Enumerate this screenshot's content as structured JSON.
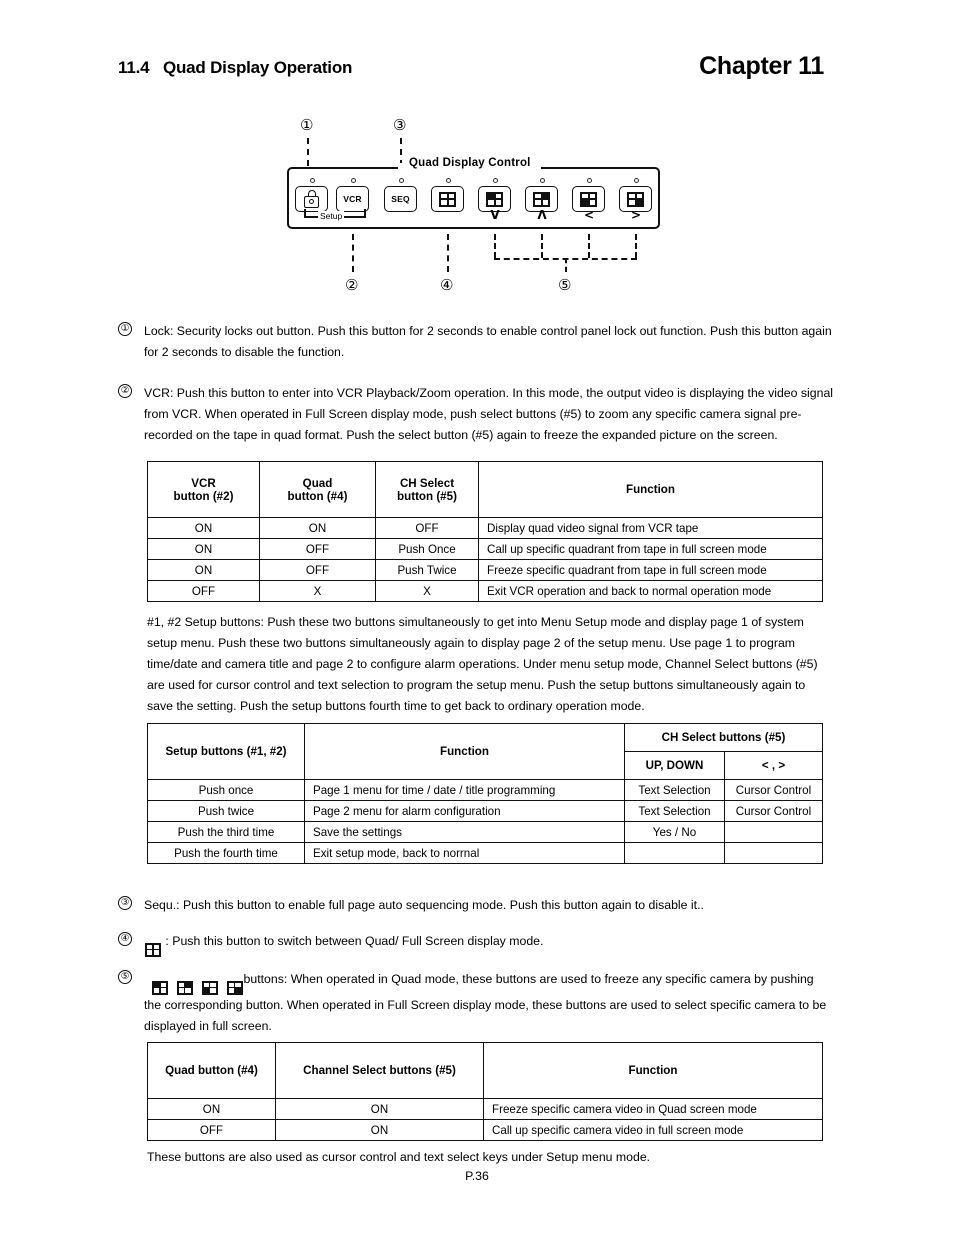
{
  "header": {
    "section_number": "11.4",
    "section_title": "Quad Display Operation",
    "chapter": "Chapter 11"
  },
  "diagram": {
    "panel_title": "Quad Display Control",
    "setup_bracket_label": "Setup",
    "callouts": [
      "①",
      "②",
      "③",
      "④",
      "⑤"
    ],
    "buttons": [
      {
        "name": "lock-button",
        "label": "",
        "icon": "lock-icon",
        "arrow": ""
      },
      {
        "name": "vcr-button",
        "label": "VCR",
        "icon": "text",
        "arrow": ""
      },
      {
        "name": "seq-button",
        "label": "SEQ",
        "icon": "text",
        "arrow": ""
      },
      {
        "name": "quad-button",
        "label": "",
        "icon": "quad-icon",
        "arrow": ""
      },
      {
        "name": "ch1-select-button",
        "label": "",
        "icon": "quad-top-left-icon",
        "arrow": "V"
      },
      {
        "name": "ch2-select-button",
        "label": "",
        "icon": "quad-top-right-icon",
        "arrow": "Λ"
      },
      {
        "name": "ch3-select-button",
        "label": "",
        "icon": "quad-bottom-left-icon",
        "arrow": "<"
      },
      {
        "name": "ch4-select-button",
        "label": "",
        "icon": "quad-bottom-right-icon",
        "arrow": ">"
      }
    ]
  },
  "items": {
    "item1": {
      "marker": "①",
      "text": "Lock: Security locks out button. Push this button for 2 seconds to enable control panel lock out function. Push this button again for 2 seconds to disable the function."
    },
    "item2": {
      "marker": "②",
      "text": "VCR: Push this button to enter into VCR Playback/Zoom operation. In this mode, the output video is displaying the video signal from VCR. When operated in Full Screen display mode, push select buttons (#5) to zoom any specific camera signal pre-recorded on the tape in quad format. Push the select button (#5) again to freeze the expanded picture on the screen."
    },
    "item3": {
      "marker": "③",
      "text": "Sequ.:    Push this button to enable full page auto sequencing mode. Push this button again to disable it.."
    },
    "item4": {
      "marker": "④",
      "text": ": Push this button to switch between Quad/ Full Screen display mode."
    },
    "item5": {
      "marker": "⑤",
      "text": "buttons:  When operated in Quad mode, these buttons are used to freeze any specific camera by pushing the corresponding button. When operated in Full Screen display mode, these buttons are used to select specific camera to be displayed in full screen."
    }
  },
  "setup_paragraph": "#1, #2 Setup buttons: Push these two buttons simultaneously to get into Menu Setup mode and display page 1 of system setup menu. Push these two buttons simultaneously again to display page 2 of the setup menu. Use page 1 to program time/date and camera title and page 2 to configure alarm operations. Under menu setup mode, Channel Select buttons (#5) are used for cursor control and text selection to program the setup menu. Push the setup buttons simultaneously again to save the setting. Push the setup buttons fourth time to get back to ordinary operation mode.",
  "table_vcr": {
    "headers": [
      "VCR\nbutton (#2)",
      "Quad\nbutton (#4)",
      "CH Select\nbutton (#5)",
      "Function"
    ],
    "headers_flat": [
      {
        "l1": "VCR",
        "l2": "button (#2)"
      },
      {
        "l1": "Quad",
        "l2": "button (#4)"
      },
      {
        "l1": "CH Select",
        "l2": "button (#5)"
      },
      {
        "l1": "Function",
        "l2": ""
      }
    ],
    "rows": [
      [
        "ON",
        "ON",
        "OFF",
        "Display quad video signal from VCR tape"
      ],
      [
        "ON",
        "OFF",
        "Push Once",
        "Call up specific quadrant from tape in full screen mode"
      ],
      [
        "ON",
        "OFF",
        "Push Twice",
        "Freeze specific quadrant from tape in full screen mode"
      ],
      [
        "OFF",
        "X",
        "X",
        "Exit VCR operation and back to normal operation mode"
      ]
    ]
  },
  "table_setup": {
    "col1_header": "Setup buttons (#1, #2)",
    "col2_header": "Function",
    "group_header": "CH Select buttons (#5)",
    "sub_headers": [
      "UP, DOWN",
      "<  ,  >"
    ],
    "rows": [
      [
        "Push once",
        "Page 1 menu for time / date / title programming",
        "Text Selection",
        "Cursor Control"
      ],
      [
        "Push twice",
        "Page 2 menu for alarm configuration",
        "Text Selection",
        "Cursor Control"
      ],
      [
        "Push the third time",
        "Save the settings",
        "Yes / No",
        ""
      ],
      [
        "Push the fourth time",
        "Exit setup mode, back to norrnal",
        "",
        ""
      ]
    ]
  },
  "table_quad": {
    "headers": [
      "Quad button (#4)",
      "Channel Select buttons (#5)",
      "Function"
    ],
    "rows": [
      [
        "ON",
        "ON",
        "Freeze specific camera video in Quad screen mode"
      ],
      [
        "OFF",
        "ON",
        "Call up specific camera video in full screen mode"
      ]
    ]
  },
  "footnote": "These buttons are also used as cursor control and text select keys under Setup menu mode.",
  "page_number": "P.36"
}
